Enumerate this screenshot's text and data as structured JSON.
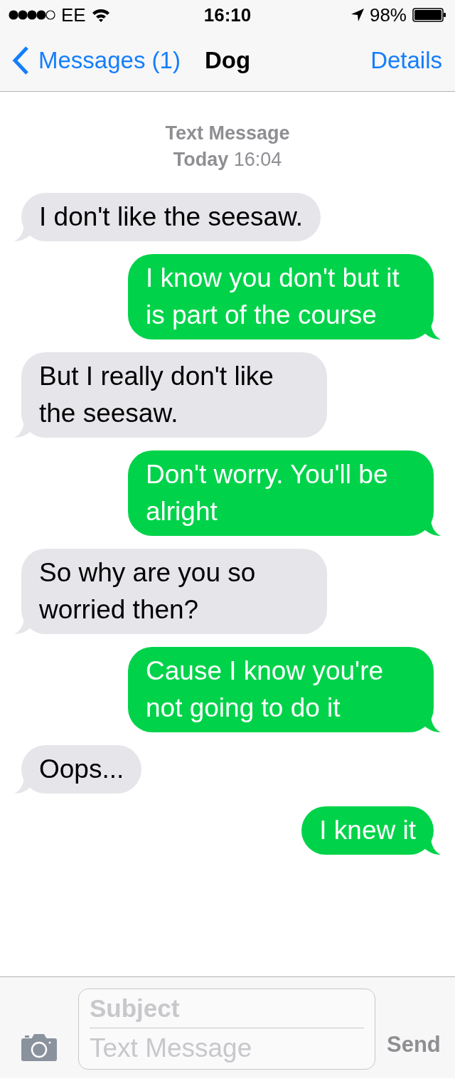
{
  "status_bar": {
    "carrier": "EE",
    "time": "16:10",
    "battery": "98%"
  },
  "nav": {
    "back": "Messages (1)",
    "title": "Dog",
    "action": "Details"
  },
  "thread_header": {
    "service": "Text Message",
    "timestamp": "**Today** 16:04"
  },
  "messages": [
    {
      "kind": "received",
      "text": "I don't like the seesaw."
    },
    {
      "kind": "sent",
      "text": "I know you don't but it is part of the course"
    },
    {
      "kind": "received",
      "text": "But I really don't like the seesaw."
    },
    {
      "kind": "sent",
      "text": "Don't worry. You'll be alright"
    },
    {
      "kind": "received",
      "text": "So why are you so worried then?"
    },
    {
      "kind": "sent",
      "text": "Cause I know you're not going to do it"
    },
    {
      "kind": "received",
      "text": "Oops..."
    },
    {
      "kind": "sent",
      "text": "I knew it"
    }
  ],
  "composer": {
    "subject_placeholder": "Subject",
    "message_placeholder": "Text Message",
    "send": "Send"
  }
}
